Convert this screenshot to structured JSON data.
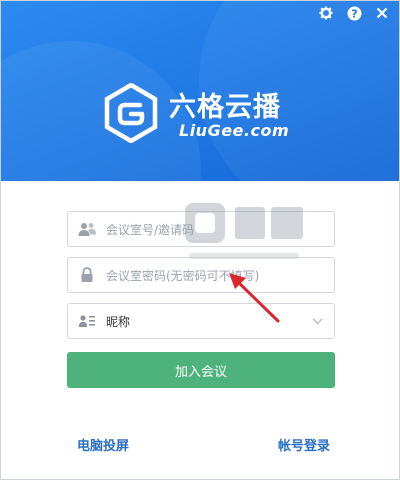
{
  "brand": {
    "name_cn": "六格云播",
    "name_en": "LiuGee.com"
  },
  "window_controls": {
    "settings_icon": "gear-icon",
    "help_icon": "question-icon",
    "close_icon": "close-icon"
  },
  "form": {
    "room_placeholder": "会议室号/邀请码",
    "password_placeholder": "会议室密码(无密码可不填写)",
    "nickname_value": "昵称",
    "join_label": "加入会议"
  },
  "links": {
    "screen_cast": "电脑投屏",
    "account_login": "帐号登录"
  },
  "colors": {
    "header": "#1f78e3",
    "join_button": "#4db37a",
    "link": "#2a6fc4"
  }
}
